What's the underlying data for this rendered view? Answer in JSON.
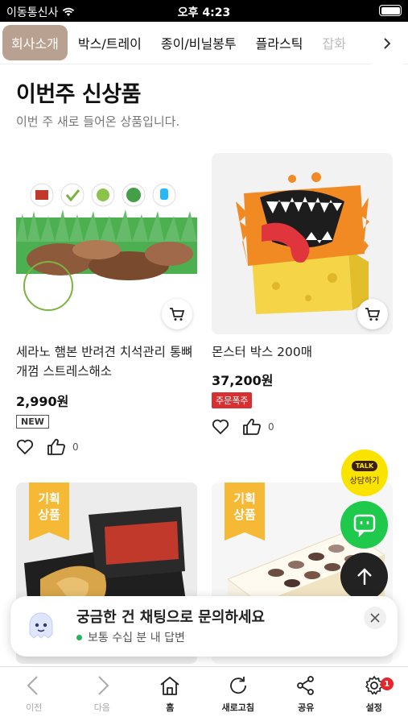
{
  "status_bar": {
    "carrier": "이동통신사",
    "time": "오후 4:23"
  },
  "category_tabs": [
    "회사소개",
    "박스/트레이",
    "종이/비닐봉투",
    "플라스틱",
    "잡화"
  ],
  "section": {
    "title": "이번주 신상품",
    "subtitle": "이번 주 새로 들어온 상품입니다."
  },
  "products": [
    {
      "name": "세라노 햄본 반려견 치석관리 통뼈 개껌 스트레스해소",
      "price": "2,990원",
      "badge": "NEW",
      "likes": "0"
    },
    {
      "name": "몬스터 박스 200매",
      "price": "37,200원",
      "badge": "주문폭주",
      "likes": "0"
    }
  ],
  "featured": [
    {
      "ribbon_line1": "기획",
      "ribbon_line2": "상품"
    },
    {
      "ribbon_line1": "기획",
      "ribbon_line2": "상품"
    }
  ],
  "floating": {
    "talk_badge": "TALK",
    "talk_label": "상담하기"
  },
  "chat_banner": {
    "title": "궁금한 건 채팅으로 문의하세요",
    "subtitle": "보통 수십 분 내 답변"
  },
  "bottom_nav": [
    {
      "label": "이전",
      "icon": "back-icon"
    },
    {
      "label": "다음",
      "icon": "forward-icon"
    },
    {
      "label": "홈",
      "icon": "home-icon"
    },
    {
      "label": "새로고침",
      "icon": "refresh-icon"
    },
    {
      "label": "공유",
      "icon": "share-icon"
    },
    {
      "label": "설정",
      "icon": "gear-icon",
      "badge": "1"
    }
  ],
  "colors": {
    "active_tab": "#b8a190",
    "ribbon": "#f5b935",
    "kakao": "#fbe300",
    "chat": "#1ec94b",
    "badge_red": "#e8252a"
  }
}
